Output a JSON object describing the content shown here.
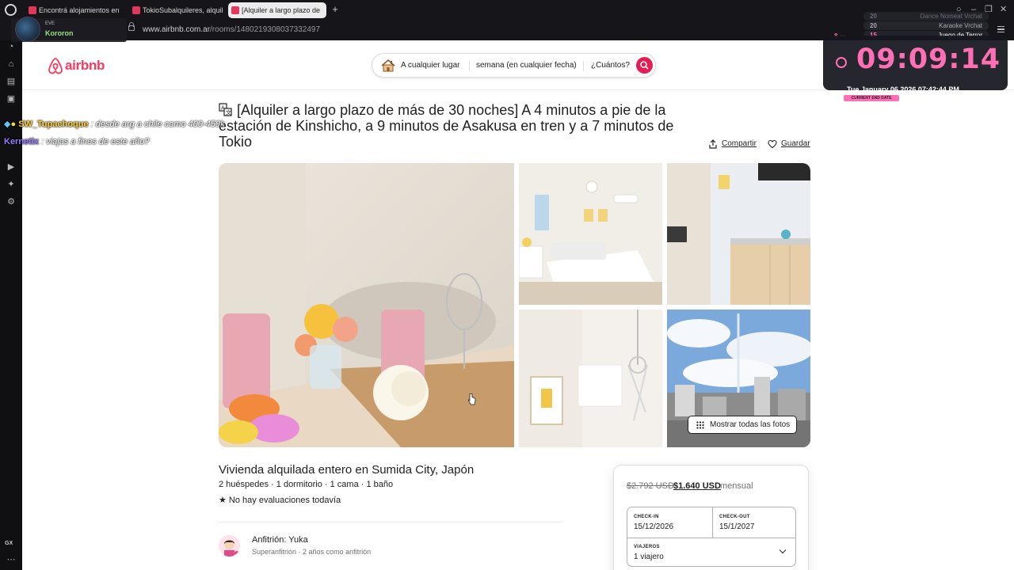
{
  "browser": {
    "tabs": [
      {
        "label": "Encontrá alojamientos en"
      },
      {
        "label": "TokioSubalquileres, alquil"
      },
      {
        "label": "[Alquiler a largo plazo de"
      }
    ],
    "url_host": "www.airbnb.com.ar",
    "url_path": "/rooms/1480219308037332497"
  },
  "header": {
    "brand": "airbnb",
    "search": {
      "where": "A cualquier lugar",
      "when": "semana (en cualquier fecha)",
      "who": "¿Cuántos?"
    }
  },
  "listing": {
    "title": "[Alquiler a largo plazo de más de 30 noches] A 4 minutos a pie de la estación de Kinshicho, a 9 minutos de Asakusa en tren y a 7 minutos de Tokio",
    "share_label": "Compartir",
    "save_label": "Guardar",
    "show_all_photos": "Mostrar todas las fotos",
    "subtitle": "Vivienda alquilada entero en Sumida City, Japón",
    "details": "2 huéspedes · 1 dormitorio · 1 cama · 1 baño",
    "reviews": "★ No hay evaluaciones todavía",
    "host_name": "Anfitrión: Yuka",
    "host_sub": "Superanfitrión · 2 años como anfitrión"
  },
  "booking": {
    "price_old": "$2.792 USD",
    "price_new": "$1.640 USD",
    "price_unit": "mensual",
    "checkin_label": "CHECK-IN",
    "checkin_value": "15/12/2026",
    "checkout_label": "CHECK-OUT",
    "checkout_value": "15/1/2027",
    "guests_label": "VIAJEROS",
    "guests_value": "1 viajero"
  },
  "overlay": {
    "profile_small": "EVE",
    "profile_name": "Kororon",
    "chat": [
      {
        "user": "SW_Tupachoque",
        "msg": ": desde arg a chile como 400-450k",
        "color": "#ffd23f"
      },
      {
        "user": "Kernetix",
        "msg": ": viajas a fines de este año?",
        "color": "#9b7bff"
      }
    ],
    "votes": [
      {
        "num": "20",
        "label": "Dance Nomeat Vrchat"
      },
      {
        "num": "20",
        "label": "Karaoke Vrchat"
      },
      {
        "num": "15",
        "label": "Juego de Terror"
      }
    ],
    "counter": "8",
    "clock_time": "09:09:14",
    "clock_date": "Tue January 06 2026 07:42:44 PM",
    "clock_badge": "CURRENT END DATE"
  },
  "sidebar": {
    "gx_label": "GX"
  },
  "colors": {
    "brand": "#ff385c",
    "search_button": "#e51d52",
    "overlay_pink": "#ff6fb5"
  },
  "icons": [
    "opera-icon",
    "lock-icon",
    "menu-icon",
    "airbnb-logo-icon",
    "house-icon",
    "search-icon",
    "translate-icon",
    "share-icon",
    "heart-icon",
    "grid-icon",
    "chevron-down-icon"
  ]
}
